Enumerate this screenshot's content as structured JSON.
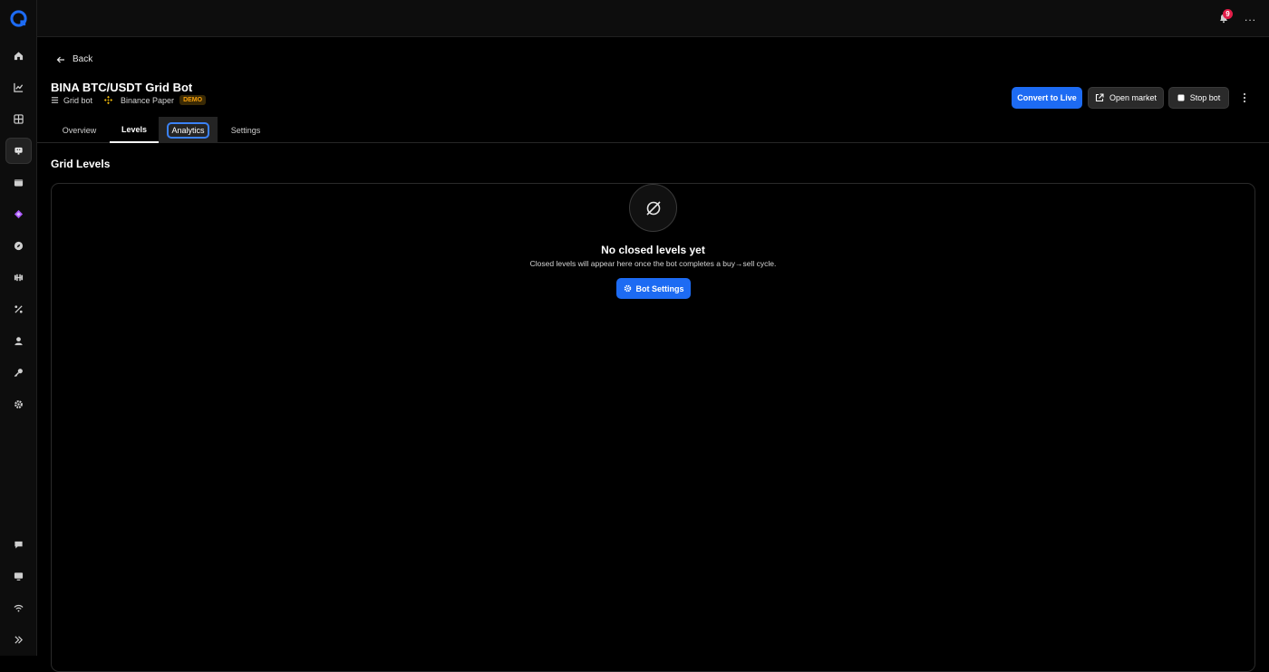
{
  "header": {
    "notification_count": "9",
    "more_label": "..."
  },
  "back_label": "Back",
  "bot": {
    "title": "BINA BTC/USDT Grid Bot",
    "type": "Grid bot",
    "exchange": "Binance Paper",
    "mode_badge": "DEMO"
  },
  "actions": {
    "convert_label": "Convert to Live",
    "open_market_label": "Open market",
    "stop_label": "Stop bot"
  },
  "tabs": [
    {
      "label": "Overview"
    },
    {
      "label": "Levels"
    },
    {
      "label": "Analytics"
    },
    {
      "label": "Settings"
    }
  ],
  "section_title": "Grid Levels",
  "empty_state": {
    "title": "No closed levels yet",
    "description": "Closed levels will appear here once the bot completes a buy→sell cycle.",
    "button_label": "Bot Settings"
  },
  "colors": {
    "accent": "#1d6bf3",
    "badge": "#e11d48",
    "demo": "#f59e0b"
  }
}
